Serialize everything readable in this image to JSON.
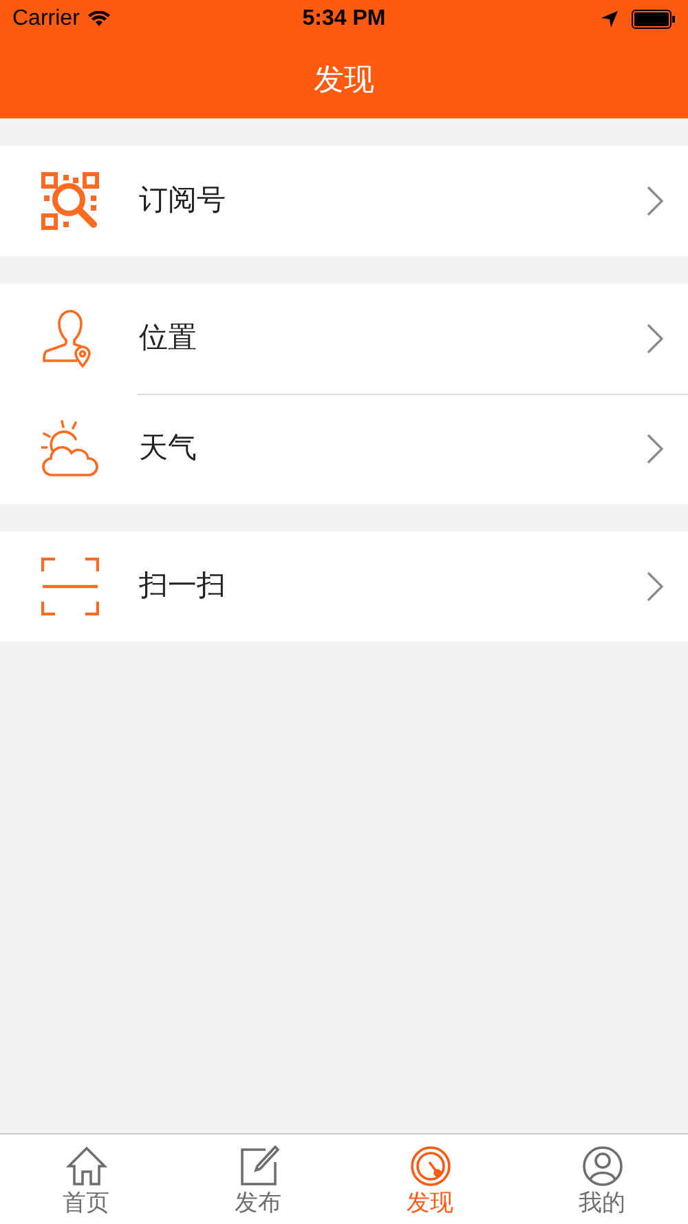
{
  "status_bar": {
    "carrier": "Carrier",
    "time": "5:34 PM"
  },
  "nav": {
    "title": "发现"
  },
  "groups": [
    {
      "items": [
        {
          "label": "订阅号",
          "kind": "qr"
        }
      ]
    },
    {
      "items": [
        {
          "label": "位置",
          "kind": "person"
        },
        {
          "label": "天气",
          "kind": "weather"
        }
      ]
    },
    {
      "items": [
        {
          "label": "扫一扫",
          "kind": "scan"
        }
      ]
    }
  ],
  "tabs": [
    {
      "label": "首页",
      "kind": "home",
      "selected": false
    },
    {
      "label": "发布",
      "kind": "edit",
      "selected": false
    },
    {
      "label": "发现",
      "kind": "discover",
      "selected": true
    },
    {
      "label": "我的",
      "kind": "profile",
      "selected": false
    }
  ]
}
